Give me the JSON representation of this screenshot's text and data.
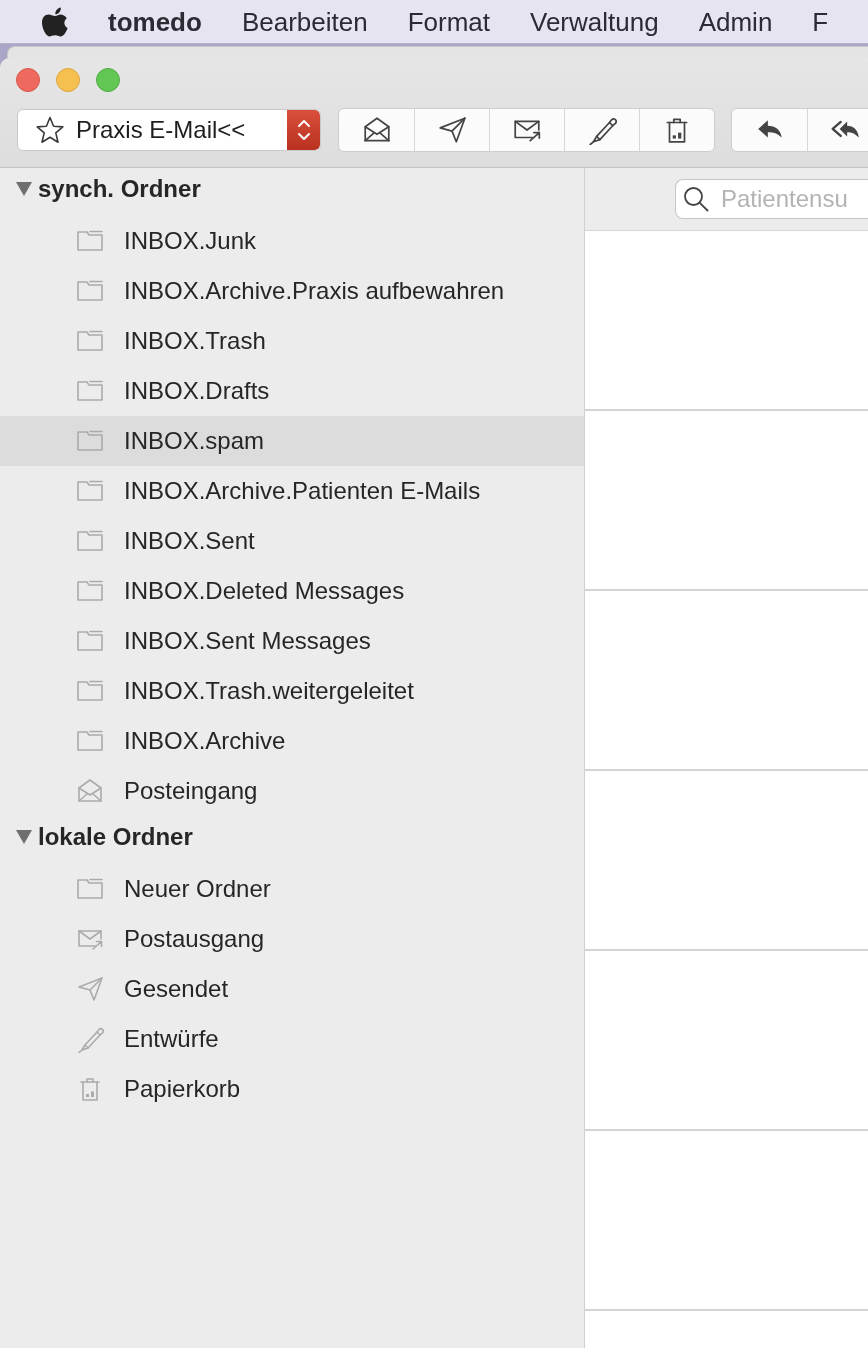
{
  "menu_bar": {
    "app_name": "tomedo",
    "items": [
      "Bearbeiten",
      "Format",
      "Verwaltung",
      "Admin",
      "F"
    ]
  },
  "toolbar": {
    "account_selector": {
      "value": "Praxis E-Mail<<"
    }
  },
  "sidebar": {
    "groups": [
      {
        "label": "synch. Ordner",
        "expanded": true,
        "children": [
          {
            "label": "INBOX.Junk",
            "kind": "folder",
            "selected": false
          },
          {
            "label": "INBOX.Archive.Praxis aufbewahren",
            "kind": "folder",
            "selected": false
          },
          {
            "label": "INBOX.Trash",
            "kind": "folder",
            "selected": false
          },
          {
            "label": "INBOX.Drafts",
            "kind": "folder",
            "selected": false
          },
          {
            "label": "INBOX.spam",
            "kind": "folder",
            "selected": true
          },
          {
            "label": "INBOX.Archive.Patienten E-Mails",
            "kind": "folder",
            "selected": false
          },
          {
            "label": "INBOX.Sent",
            "kind": "folder",
            "selected": false
          },
          {
            "label": "INBOX.Deleted Messages",
            "kind": "folder",
            "selected": false
          },
          {
            "label": "INBOX.Sent Messages",
            "kind": "folder",
            "selected": false
          },
          {
            "label": "INBOX.Trash.weitergeleitet",
            "kind": "folder",
            "selected": false
          },
          {
            "label": "INBOX.Archive",
            "kind": "folder",
            "selected": false
          },
          {
            "label": "Posteingang",
            "kind": "inbox",
            "selected": false
          }
        ]
      },
      {
        "label": "lokale Ordner",
        "expanded": true,
        "children": [
          {
            "label": "Neuer Ordner",
            "kind": "folder",
            "selected": false
          },
          {
            "label": "Postausgang",
            "kind": "outbox",
            "selected": false
          },
          {
            "label": "Gesendet",
            "kind": "sent",
            "selected": false
          },
          {
            "label": "Entwürfe",
            "kind": "drafts",
            "selected": false
          },
          {
            "label": "Papierkorb",
            "kind": "trash",
            "selected": false
          }
        ]
      }
    ]
  },
  "search": {
    "placeholder": "Patientensu"
  }
}
